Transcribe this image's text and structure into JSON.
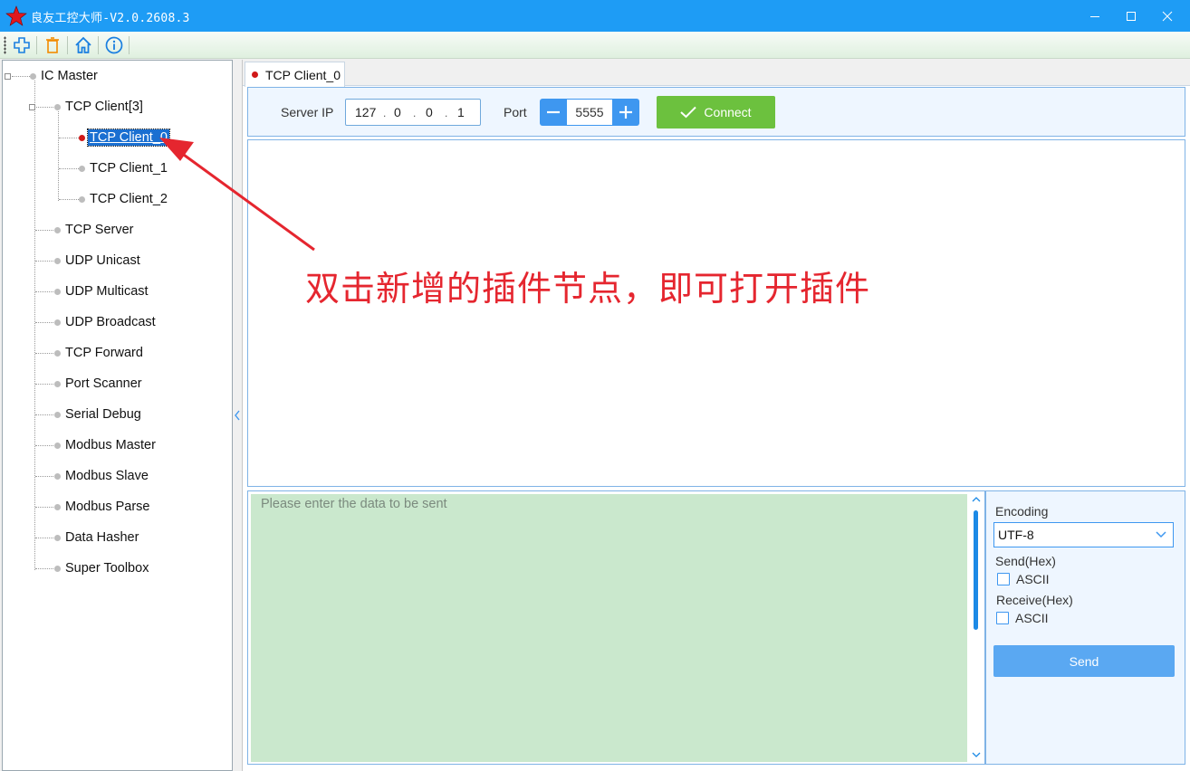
{
  "window": {
    "title": "良友工控大师-V2.0.2608.3",
    "accent_color": "#1e9cf5"
  },
  "toolbar": {
    "icons": [
      "add-icon",
      "delete-icon",
      "home-icon",
      "info-icon"
    ]
  },
  "tree": {
    "root": "IC Master",
    "tcp_client_group": "TCP Client[3]",
    "clients": [
      "TCP Client_0",
      "TCP Client_1",
      "TCP Client_2"
    ],
    "selected": "TCP Client_0",
    "plugins": [
      "TCP Server",
      "UDP Unicast",
      "UDP Multicast",
      "UDP Broadcast",
      "TCP Forward",
      "Port Scanner",
      "Serial Debug",
      "Modbus Master",
      "Modbus Slave",
      "Modbus Parse",
      "Data Hasher",
      "Super Toolbox"
    ]
  },
  "tab": {
    "label": "TCP Client_0"
  },
  "connection": {
    "server_ip_label": "Server IP",
    "ip": [
      "127",
      "0",
      "0",
      "1"
    ],
    "port_label": "Port",
    "port": "5555",
    "connect_label": "Connect",
    "connect_color": "#6cc13e"
  },
  "send": {
    "placeholder": "Please enter the data to be sent"
  },
  "options": {
    "encoding_label": "Encoding",
    "encoding_value": "UTF-8",
    "send_hex_label": "Send(Hex)",
    "send_ascii_label": "ASCII",
    "receive_hex_label": "Receive(Hex)",
    "receive_ascii_label": "ASCII",
    "send_button_label": "Send"
  },
  "annotation": {
    "text": "双击新增的插件节点，即可打开插件",
    "color": "#e5262f"
  }
}
